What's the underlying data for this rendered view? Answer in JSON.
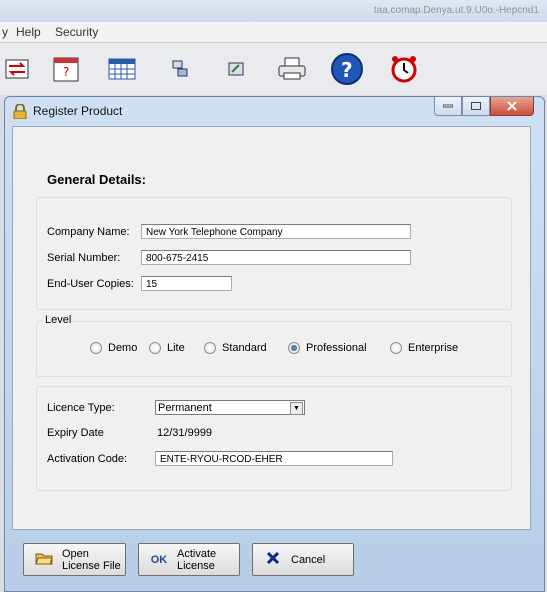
{
  "app": {
    "title_text": "taa.comap.Denya.ut.9.U0o.-Hepcnd1",
    "menu": [
      "Help",
      "Security"
    ]
  },
  "toolbar": {
    "icons": [
      "transfer-icon",
      "calendar-question-icon",
      "calendar-grid-icon",
      "network-icon",
      "edit-window-icon",
      "printer-icon",
      "help-icon",
      "alarm-clock-icon"
    ]
  },
  "dialog": {
    "title": "Register Product",
    "section_title": "General Details:",
    "company_label": "Company Name:",
    "company_value": "New York Telephone Company",
    "serial_label": "Serial Number:",
    "serial_value": "800-675-2415",
    "copies_label": "End-User Copies:",
    "copies_value": "15",
    "level_label": "Level",
    "levels": [
      "Demo",
      "Lite",
      "Standard",
      "Professional",
      "Enterprise"
    ],
    "selected_level": "Professional",
    "licence_type_label": "Licence Type:",
    "licence_type_value": "Permanent",
    "expiry_label": "Expiry Date",
    "expiry_value": "12/31/9999",
    "activation_label": "Activation Code:",
    "activation_value": "ENTE-RYOU-RCOD-EHER"
  },
  "buttons": {
    "open_line1": "Open",
    "open_line2": "License File",
    "activate_icon_text": "OK",
    "activate_line1": "Activate",
    "activate_line2": "License",
    "cancel_label": "Cancel"
  },
  "colors": {
    "accent": "#1f4d86",
    "close_button": "#c8513c"
  }
}
